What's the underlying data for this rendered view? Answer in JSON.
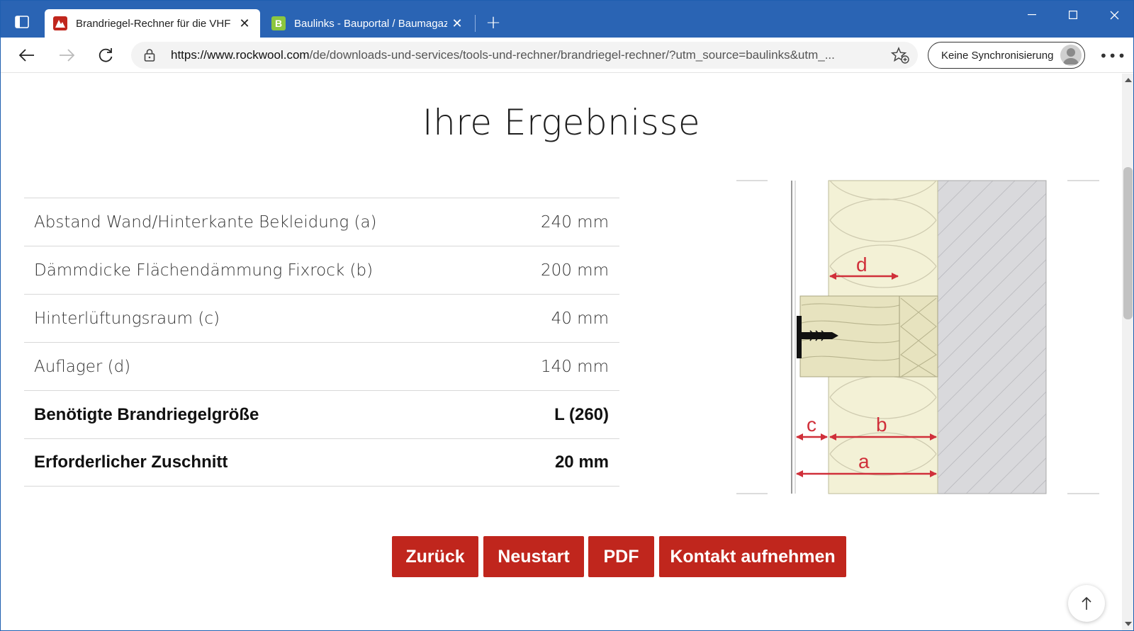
{
  "browser": {
    "tabs": [
      {
        "title": "Brandriegel-Rechner für die VHF",
        "favicon": "rockwool-logo-icon",
        "favicon_color": "#c0261d",
        "active": true
      },
      {
        "title": "Baulinks - Bauportal / Baumagazin",
        "favicon": "baulinks-b-icon",
        "favicon_color": "#8cc63f",
        "active": false
      }
    ],
    "url_host": "https://www.rockwool.com",
    "url_path": "/de/downloads-und-services/tools-und-rechner/brandriegel-rechner/?utm_source=baulinks&utm_...",
    "sync_label": "Keine Synchronisierung",
    "titlebar_color": "#2a64b4"
  },
  "page": {
    "heading": "Ihre Ergebnisse",
    "results": [
      {
        "label": "Abstand Wand/Hinterkante Bekleidung (a)",
        "value": "240 mm",
        "bold": false
      },
      {
        "label": "Dämmdicke Flächendämmung Fixrock (b)",
        "value": "200 mm",
        "bold": false
      },
      {
        "label": "Hinterlüftungsraum (c)",
        "value": "40 mm",
        "bold": false
      },
      {
        "label": "Auflager (d)",
        "value": "140 mm",
        "bold": false
      },
      {
        "label": "Benötigte Brandriegelgröße",
        "value": "L (260)",
        "bold": true
      },
      {
        "label": "Erforderlicher Zuschnitt",
        "value": "20 mm",
        "bold": true
      }
    ],
    "diagram_labels": {
      "a": "a",
      "b": "b",
      "c": "c",
      "d": "d"
    },
    "buttons": {
      "back": "Zurück",
      "restart": "Neustart",
      "pdf": "PDF",
      "contact": "Kontakt aufnehmen"
    },
    "accent_color": "#c0261d"
  }
}
